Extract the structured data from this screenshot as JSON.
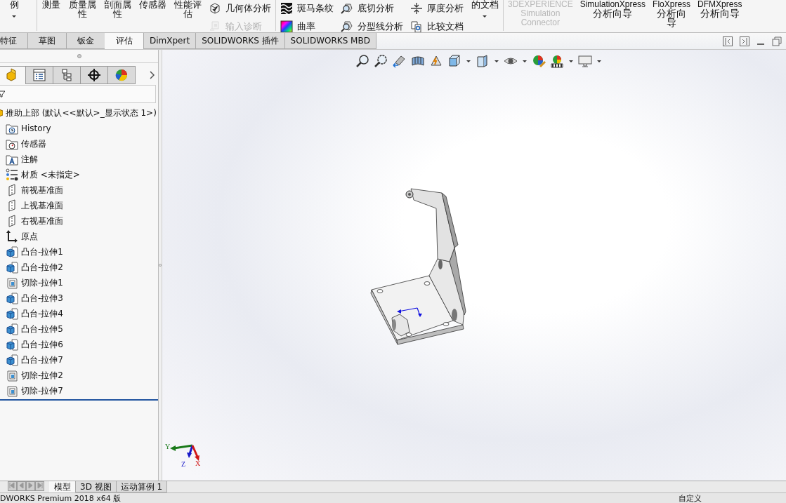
{
  "ribbon": {
    "groups": [
      {
        "items": [
          {
            "kind": "large",
            "label": "例",
            "caret": true
          }
        ]
      },
      {
        "items": [
          {
            "kind": "large",
            "label": "测量",
            "caret": false
          },
          {
            "kind": "large",
            "label": "质量属性",
            "caret": false
          },
          {
            "kind": "large",
            "label": "剖面属性",
            "caret": false
          },
          {
            "kind": "large",
            "label": "传感器",
            "caret": false
          },
          {
            "kind": "large",
            "label": "性能评估",
            "caret": false
          },
          {
            "kind": "stack",
            "buttons": [
              {
                "kind": "geometry",
                "label": "几何体分析",
                "disabled": false
              },
              {
                "kind": "diagnostics",
                "label": "输入诊断",
                "disabled": true
              }
            ]
          }
        ]
      },
      {
        "items": [
          {
            "kind": "stack",
            "buttons": [
              {
                "kind": "zebra",
                "label": "斑马条纹",
                "disabled": false
              },
              {
                "kind": "curvature",
                "label": "曲率",
                "disabled": false
              }
            ]
          },
          {
            "kind": "stack",
            "buttons": [
              {
                "kind": "undercut",
                "label": "底切分析",
                "disabled": false
              },
              {
                "kind": "parting",
                "label": "分型线分析",
                "disabled": false
              }
            ]
          },
          {
            "kind": "stack",
            "buttons": [
              {
                "kind": "thickness",
                "label": "厚度分析",
                "disabled": false
              },
              {
                "kind": "compare",
                "label": "比较文档",
                "disabled": false
              }
            ]
          },
          {
            "kind": "large",
            "label": "的文档",
            "caret": true
          }
        ]
      },
      {
        "items": [
          {
            "kind": "xpress",
            "title": "3DEXPERIENCE",
            "subtitle": "Simulation Connector",
            "disabled": true
          },
          {
            "kind": "xpress",
            "title": "SimulationXpress",
            "subtitle": "分析向导",
            "disabled": false
          },
          {
            "kind": "xpress",
            "title": "FloXpress",
            "subtitle": "分析向导",
            "disabled": false
          },
          {
            "kind": "xpress",
            "title": "DFMXpress",
            "subtitle": "分析向导",
            "disabled": false
          }
        ]
      }
    ]
  },
  "command_tabs": [
    {
      "label": "特征",
      "selected": false
    },
    {
      "label": "草图",
      "selected": false
    },
    {
      "label": "钣金",
      "selected": false
    },
    {
      "label": "评估",
      "selected": true
    },
    {
      "label": "DimXpert",
      "selected": false
    },
    {
      "label": "SOLIDWORKS 插件",
      "selected": false
    },
    {
      "label": "SOLIDWORKS MBD",
      "selected": false
    }
  ],
  "feature_manager": {
    "tabs": [
      {
        "kind": "features",
        "selected": true
      },
      {
        "kind": "properties",
        "selected": false
      },
      {
        "kind": "configurations",
        "selected": false
      },
      {
        "kind": "dimxpert",
        "selected": false
      },
      {
        "kind": "display",
        "selected": false
      }
    ],
    "tree": {
      "label": "推助上部 (默认<<默认>_显示状态 1>)",
      "kind": "part",
      "children": [
        {
          "label": "History",
          "kind": "history"
        },
        {
          "label": "传感器",
          "kind": "sensors"
        },
        {
          "label": "注解",
          "kind": "annotations"
        },
        {
          "label": "材质 <未指定>",
          "kind": "material"
        },
        {
          "label": "前视基准面",
          "kind": "plane"
        },
        {
          "label": "上视基准面",
          "kind": "plane"
        },
        {
          "label": "右视基准面",
          "kind": "plane"
        },
        {
          "label": "原点",
          "kind": "origin"
        },
        {
          "label": "凸台-拉伸1",
          "kind": "boss"
        },
        {
          "label": "凸台-拉伸2",
          "kind": "boss"
        },
        {
          "label": "切除-拉伸1",
          "kind": "cut"
        },
        {
          "label": "凸台-拉伸3",
          "kind": "boss"
        },
        {
          "label": "凸台-拉伸4",
          "kind": "boss"
        },
        {
          "label": "凸台-拉伸5",
          "kind": "boss"
        },
        {
          "label": "凸台-拉伸6",
          "kind": "boss"
        },
        {
          "label": "凸台-拉伸7",
          "kind": "boss"
        },
        {
          "label": "切除-拉伸2",
          "kind": "cut"
        },
        {
          "label": "切除-拉伸7",
          "kind": "cut"
        }
      ]
    }
  },
  "viewport": {
    "triad": [
      {
        "label": "Y",
        "color": "#1a7a1a"
      },
      {
        "label": "Z",
        "color": "#1818c8"
      },
      {
        "label": "X",
        "color": "#d01818"
      }
    ]
  },
  "view_tabs": [
    {
      "label": "模型",
      "selected": true
    },
    {
      "label": "3D 视图",
      "selected": false
    },
    {
      "label": "运动算例 1",
      "selected": false
    }
  ],
  "status_bar": {
    "text": "DWORKS Premium 2018 x64 版",
    "mode": "自定义"
  }
}
